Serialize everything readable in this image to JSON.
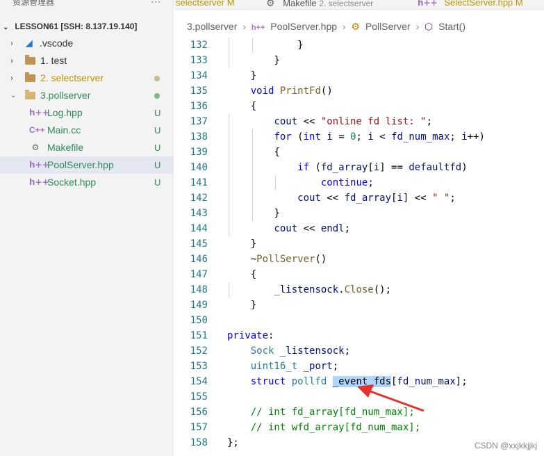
{
  "explorer": {
    "title": "资源管理器",
    "more": "···",
    "section": "LESSON61 [SSH: 8.137.19.140]",
    "items": [
      {
        "label": ".vscode",
        "icon": "vscode-folder-icon"
      },
      {
        "label": "1. test",
        "icon": "folder-icon"
      },
      {
        "label": "2. selectserver",
        "icon": "folder-icon",
        "color": "#2e8b57"
      },
      {
        "label": "3.pollserver",
        "icon": "folder-open-icon",
        "color": "#2e8b57"
      },
      {
        "label": "Log.hpp",
        "icon": "hpp-file-icon",
        "badge": "U"
      },
      {
        "label": "Main.cc",
        "icon": "cpp-file-icon",
        "badge": "U"
      },
      {
        "label": "Makefile",
        "icon": "makefile-icon",
        "badge": "U"
      },
      {
        "label": "PoolServer.hpp",
        "icon": "hpp-file-icon",
        "badge": "U"
      },
      {
        "label": "Socket.hpp",
        "icon": "hpp-file-icon",
        "badge": "U"
      }
    ],
    "colors": {
      "modified": "#b89500",
      "untracked": "#2e8b57",
      "dot_modified": "#c8b88a",
      "dot_untracked": "#7fb77f"
    }
  },
  "tabs": [
    {
      "name": "selectserver",
      "marker": "M"
    },
    {
      "name": "Makefile",
      "sub": "2. selectserver"
    },
    {
      "name": "SelectServer.hpp",
      "marker": "M"
    }
  ],
  "breadcrumb": {
    "folder": "3.pollserver",
    "file": "PoolServer.hpp",
    "klass": "PollServer",
    "method": "Start()"
  },
  "code_lines": [
    {
      "n": "132",
      "indent": 3,
      "tokens": [
        [
          "p",
          "}"
        ]
      ]
    },
    {
      "n": "133",
      "indent": 2,
      "tokens": [
        [
          "p",
          "}"
        ]
      ]
    },
    {
      "n": "134",
      "indent": 1,
      "tokens": [
        [
          "p",
          "}"
        ]
      ]
    },
    {
      "n": "135",
      "indent": 1,
      "tokens": [
        [
          "k",
          "void"
        ],
        [
          "p",
          " "
        ],
        [
          "f",
          "PrintFd"
        ],
        [
          "p",
          "()"
        ]
      ]
    },
    {
      "n": "136",
      "indent": 1,
      "tokens": [
        [
          "p",
          "{"
        ]
      ]
    },
    {
      "n": "137",
      "indent": 2,
      "tokens": [
        [
          "v",
          "cout"
        ],
        [
          "p",
          " << "
        ],
        [
          "s",
          "\"online fd list: \""
        ],
        [
          "p",
          ";"
        ]
      ]
    },
    {
      "n": "138",
      "indent": 2,
      "tokens": [
        [
          "k",
          "for"
        ],
        [
          "p",
          " ("
        ],
        [
          "k",
          "int"
        ],
        [
          "p",
          " "
        ],
        [
          "v",
          "i"
        ],
        [
          "p",
          " = "
        ],
        [
          "n",
          "0"
        ],
        [
          "p",
          "; "
        ],
        [
          "v",
          "i"
        ],
        [
          "p",
          " < "
        ],
        [
          "v",
          "fd_num_max"
        ],
        [
          "p",
          "; "
        ],
        [
          "v",
          "i"
        ],
        [
          "p",
          "++)"
        ]
      ]
    },
    {
      "n": "139",
      "indent": 2,
      "tokens": [
        [
          "p",
          "{"
        ]
      ]
    },
    {
      "n": "140",
      "indent": 3,
      "tokens": [
        [
          "k",
          "if"
        ],
        [
          "p",
          " ("
        ],
        [
          "v",
          "fd_array"
        ],
        [
          "p",
          "["
        ],
        [
          "v",
          "i"
        ],
        [
          "p",
          "] == "
        ],
        [
          "v",
          "defaultfd"
        ],
        [
          "p",
          ")"
        ]
      ]
    },
    {
      "n": "141",
      "indent": 4,
      "tokens": [
        [
          "k",
          "continue"
        ],
        [
          "p",
          ";"
        ]
      ]
    },
    {
      "n": "142",
      "indent": 3,
      "tokens": [
        [
          "v",
          "cout"
        ],
        [
          "p",
          " << "
        ],
        [
          "v",
          "fd_array"
        ],
        [
          "p",
          "["
        ],
        [
          "v",
          "i"
        ],
        [
          "p",
          "] << "
        ],
        [
          "s",
          "\" \""
        ],
        [
          "p",
          ";"
        ]
      ]
    },
    {
      "n": "143",
      "indent": 2,
      "tokens": [
        [
          "p",
          "}"
        ]
      ]
    },
    {
      "n": "144",
      "indent": 2,
      "tokens": [
        [
          "v",
          "cout"
        ],
        [
          "p",
          " << "
        ],
        [
          "v",
          "endl"
        ],
        [
          "p",
          ";"
        ]
      ]
    },
    {
      "n": "145",
      "indent": 1,
      "tokens": [
        [
          "p",
          "}"
        ]
      ]
    },
    {
      "n": "146",
      "indent": 1,
      "tokens": [
        [
          "p",
          "~"
        ],
        [
          "f",
          "PollServer"
        ],
        [
          "p",
          "()"
        ]
      ]
    },
    {
      "n": "147",
      "indent": 1,
      "tokens": [
        [
          "p",
          "{"
        ]
      ]
    },
    {
      "n": "148",
      "indent": 2,
      "tokens": [
        [
          "v",
          "_listensock"
        ],
        [
          "p",
          "."
        ],
        [
          "f",
          "Close"
        ],
        [
          "p",
          "();"
        ]
      ]
    },
    {
      "n": "149",
      "indent": 1,
      "tokens": [
        [
          "p",
          "}"
        ]
      ]
    },
    {
      "n": "150",
      "indent": 0,
      "tokens": []
    },
    {
      "n": "151",
      "indent": 0,
      "tokens": [
        [
          "k",
          "private"
        ],
        [
          "p",
          ":"
        ]
      ]
    },
    {
      "n": "152",
      "indent": 1,
      "tokens": [
        [
          "t",
          "Sock"
        ],
        [
          "p",
          " "
        ],
        [
          "v",
          "_listensock"
        ],
        [
          "p",
          ";"
        ]
      ]
    },
    {
      "n": "153",
      "indent": 1,
      "tokens": [
        [
          "t",
          "uint16_t"
        ],
        [
          "p",
          " "
        ],
        [
          "v",
          "_port"
        ],
        [
          "p",
          ";"
        ]
      ]
    },
    {
      "n": "154",
      "indent": 1,
      "tokens": [
        [
          "k",
          "struct"
        ],
        [
          "p",
          " "
        ],
        [
          "t",
          "pollfd"
        ],
        [
          "p",
          " "
        ],
        [
          "hl",
          "_event_fds"
        ],
        [
          "p",
          "["
        ],
        [
          "v",
          "fd_num_max"
        ],
        [
          "p",
          "];"
        ]
      ]
    },
    {
      "n": "155",
      "indent": 0,
      "tokens": []
    },
    {
      "n": "156",
      "indent": 1,
      "tokens": [
        [
          "c",
          "// int fd_array[fd_num_max];"
        ]
      ]
    },
    {
      "n": "157",
      "indent": 1,
      "tokens": [
        [
          "c",
          "// int wfd_array[fd_num_max];"
        ]
      ]
    },
    {
      "n": "158",
      "indent": 0,
      "tokens": [
        [
          "p",
          "};"
        ]
      ]
    }
  ],
  "annotation": {
    "arrow_color": "#e5322d"
  },
  "watermark": "CSDN @xxjkkjjkj"
}
